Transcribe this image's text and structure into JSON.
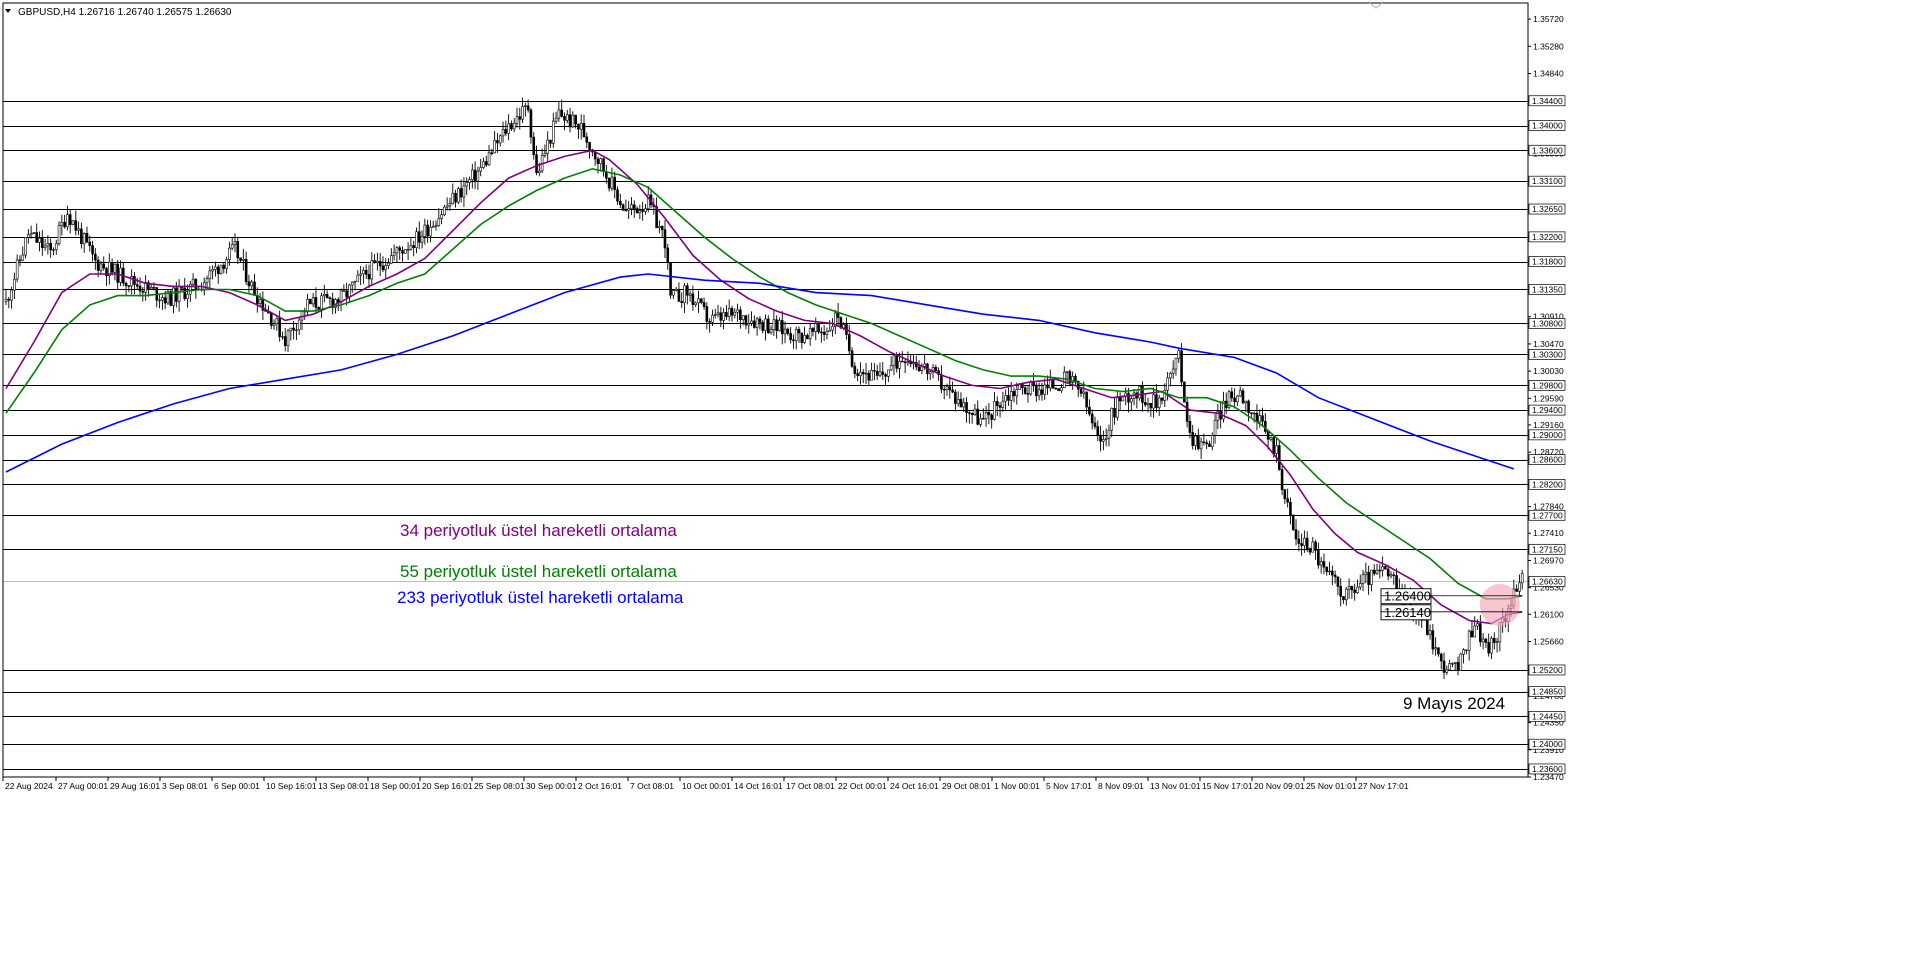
{
  "chart_data": {
    "type": "candlestick",
    "symbol_header": "GBPUSD,H4  1.26716 1.26740 1.26575 1.26630",
    "ylim": [
      1.2347,
      1.3598
    ],
    "y_ticks": [
      "1.35720",
      "1.35280",
      "1.34840",
      "1.34400",
      "1.34000",
      "1.33600",
      "1.33550",
      "1.33100",
      "1.32650",
      "1.32200",
      "1.31800",
      "1.31350",
      "1.30910",
      "1.30800",
      "1.30470",
      "1.30300",
      "1.30030",
      "1.29800",
      "1.29590",
      "1.29400",
      "1.29160",
      "1.29000",
      "1.28720",
      "1.28600",
      "1.28200",
      "1.27840",
      "1.27700",
      "1.27410",
      "1.27150",
      "1.26970",
      "1.26630",
      "1.26530",
      "1.26100",
      "1.25660",
      "1.25200",
      "1.24850",
      "1.24780",
      "1.24450",
      "1.24350",
      "1.23910",
      "1.24000",
      "1.23600",
      "1.23470"
    ],
    "x_ticks": [
      "22 Aug 2024",
      "27 Aug 00:01",
      "29 Aug 16:01",
      "3 Sep 08:01",
      "6 Sep 00:01",
      "10 Sep 16:01",
      "13 Sep 08:01",
      "18 Sep 00:01",
      "20 Sep 16:01",
      "25 Sep 08:01",
      "30 Sep 00:01",
      "2 Oct 16:01",
      "7 Oct 08:01",
      "10 Oct 00:01",
      "14 Oct 16:01",
      "17 Oct 08:01",
      "22 Oct 00:01",
      "24 Oct 16:01",
      "29 Oct 08:01",
      "1 Nov 00:01",
      "5 Nov 17:01",
      "8 Nov 09:01",
      "13 Nov 01:01",
      "15 Nov 17:01",
      "20 Nov 09:01",
      "25 Nov 01:01",
      "27 Nov 17:01"
    ],
    "horizontal_levels": [
      1.344,
      1.34,
      1.336,
      1.331,
      1.3265,
      1.322,
      1.318,
      1.3135,
      1.308,
      1.303,
      1.298,
      1.294,
      1.29,
      1.286,
      1.282,
      1.277,
      1.2715,
      1.252,
      1.2485,
      1.2445,
      1.24,
      1.236
    ],
    "current_price": 1.2663,
    "price_path": [
      [
        0,
        1.3115
      ],
      [
        8,
        1.3225
      ],
      [
        16,
        1.3195
      ],
      [
        22,
        1.326
      ],
      [
        32,
        1.318
      ],
      [
        44,
        1.315
      ],
      [
        58,
        1.312
      ],
      [
        70,
        1.3145
      ],
      [
        82,
        1.32
      ],
      [
        88,
        1.314
      ],
      [
        100,
        1.3055
      ],
      [
        108,
        1.311
      ],
      [
        120,
        1.312
      ],
      [
        130,
        1.3165
      ],
      [
        140,
        1.3195
      ],
      [
        148,
        1.322
      ],
      [
        160,
        1.328
      ],
      [
        170,
        1.333
      ],
      [
        180,
        1.34
      ],
      [
        187,
        1.343
      ],
      [
        190,
        1.332
      ],
      [
        198,
        1.342
      ],
      [
        206,
        1.3395
      ],
      [
        214,
        1.333
      ],
      [
        222,
        1.326
      ],
      [
        230,
        1.3275
      ],
      [
        236,
        1.3215
      ],
      [
        238,
        1.312
      ],
      [
        244,
        1.313
      ],
      [
        252,
        1.3085
      ],
      [
        262,
        1.3095
      ],
      [
        272,
        1.308
      ],
      [
        284,
        1.306
      ],
      [
        294,
        1.307
      ],
      [
        298,
        1.3095
      ],
      [
        304,
        1.301
      ],
      [
        312,
        1.299
      ],
      [
        322,
        1.303
      ],
      [
        330,
        1.3005
      ],
      [
        340,
        1.296
      ],
      [
        350,
        1.292
      ],
      [
        356,
        1.2955
      ],
      [
        362,
        1.2975
      ],
      [
        372,
        1.2975
      ],
      [
        380,
        1.299
      ],
      [
        385,
        1.297
      ],
      [
        392,
        1.288
      ],
      [
        398,
        1.2955
      ],
      [
        404,
        1.297
      ],
      [
        412,
        1.295
      ],
      [
        420,
        1.3025
      ],
      [
        424,
        1.29
      ],
      [
        430,
        1.288
      ],
      [
        436,
        1.295
      ],
      [
        442,
        1.297
      ],
      [
        450,
        1.291
      ],
      [
        455,
        1.2875
      ],
      [
        458,
        1.28
      ],
      [
        462,
        1.273
      ],
      [
        468,
        1.272
      ],
      [
        472,
        1.268
      ],
      [
        480,
        1.264
      ],
      [
        486,
        1.2665
      ],
      [
        494,
        1.268
      ],
      [
        500,
        1.264
      ],
      [
        508,
        1.26
      ],
      [
        514,
        1.253
      ],
      [
        520,
        1.252
      ],
      [
        526,
        1.26
      ],
      [
        530,
        1.2555
      ],
      [
        534,
        1.257
      ],
      [
        540,
        1.265
      ],
      [
        543,
        1.2663
      ]
    ],
    "series": [
      {
        "name": "34 periyotluk üstel hareketli ortalama",
        "color": "#800080",
        "points": [
          [
            0,
            1.2975
          ],
          [
            10,
            1.305
          ],
          [
            20,
            1.313
          ],
          [
            30,
            1.316
          ],
          [
            40,
            1.316
          ],
          [
            50,
            1.3145
          ],
          [
            60,
            1.314
          ],
          [
            70,
            1.314
          ],
          [
            80,
            1.313
          ],
          [
            90,
            1.311
          ],
          [
            100,
            1.3085
          ],
          [
            110,
            1.3095
          ],
          [
            120,
            1.3115
          ],
          [
            130,
            1.314
          ],
          [
            140,
            1.316
          ],
          [
            150,
            1.3185
          ],
          [
            160,
            1.323
          ],
          [
            170,
            1.3275
          ],
          [
            180,
            1.3315
          ],
          [
            190,
            1.3335
          ],
          [
            200,
            1.335
          ],
          [
            210,
            1.336
          ],
          [
            216,
            1.3345
          ],
          [
            226,
            1.3305
          ],
          [
            236,
            1.325
          ],
          [
            246,
            1.319
          ],
          [
            256,
            1.315
          ],
          [
            266,
            1.312
          ],
          [
            276,
            1.31
          ],
          [
            286,
            1.3085
          ],
          [
            296,
            1.308
          ],
          [
            306,
            1.306
          ],
          [
            316,
            1.3035
          ],
          [
            326,
            1.3015
          ],
          [
            336,
            1.2995
          ],
          [
            346,
            1.298
          ],
          [
            356,
            1.2975
          ],
          [
            366,
            1.2985
          ],
          [
            376,
            1.299
          ],
          [
            386,
            1.2975
          ],
          [
            396,
            1.296
          ],
          [
            406,
            1.2965
          ],
          [
            414,
            1.297
          ],
          [
            424,
            1.294
          ],
          [
            434,
            1.2935
          ],
          [
            444,
            1.2915
          ],
          [
            452,
            1.288
          ],
          [
            460,
            1.2835
          ],
          [
            468,
            1.278
          ],
          [
            476,
            1.274
          ],
          [
            484,
            1.271
          ],
          [
            494,
            1.269
          ],
          [
            504,
            1.2665
          ],
          [
            514,
            1.2625
          ],
          [
            524,
            1.26
          ],
          [
            532,
            1.2595
          ],
          [
            538,
            1.261
          ],
          [
            543,
            1.2614
          ]
        ]
      },
      {
        "name": "55 periyotluk üstel hareketli ortalama",
        "color": "#008000",
        "points": [
          [
            0,
            1.2935
          ],
          [
            10,
            1.3
          ],
          [
            20,
            1.307
          ],
          [
            30,
            1.311
          ],
          [
            40,
            1.3125
          ],
          [
            50,
            1.3125
          ],
          [
            60,
            1.313
          ],
          [
            70,
            1.3135
          ],
          [
            80,
            1.3135
          ],
          [
            90,
            1.3125
          ],
          [
            100,
            1.31
          ],
          [
            110,
            1.31
          ],
          [
            120,
            1.311
          ],
          [
            130,
            1.3125
          ],
          [
            140,
            1.3145
          ],
          [
            150,
            1.316
          ],
          [
            160,
            1.32
          ],
          [
            170,
            1.324
          ],
          [
            180,
            1.327
          ],
          [
            190,
            1.3295
          ],
          [
            200,
            1.3315
          ],
          [
            210,
            1.333
          ],
          [
            220,
            1.332
          ],
          [
            230,
            1.33
          ],
          [
            240,
            1.326
          ],
          [
            250,
            1.322
          ],
          [
            260,
            1.3185
          ],
          [
            270,
            1.3155
          ],
          [
            280,
            1.313
          ],
          [
            290,
            1.311
          ],
          [
            300,
            1.3095
          ],
          [
            310,
            1.308
          ],
          [
            320,
            1.306
          ],
          [
            330,
            1.304
          ],
          [
            340,
            1.302
          ],
          [
            350,
            1.3005
          ],
          [
            360,
            1.2995
          ],
          [
            370,
            1.2995
          ],
          [
            380,
            1.299
          ],
          [
            390,
            1.2975
          ],
          [
            400,
            1.297
          ],
          [
            410,
            1.2975
          ],
          [
            420,
            1.296
          ],
          [
            430,
            1.296
          ],
          [
            440,
            1.2945
          ],
          [
            450,
            1.2915
          ],
          [
            460,
            1.2875
          ],
          [
            470,
            1.283
          ],
          [
            480,
            1.279
          ],
          [
            490,
            1.276
          ],
          [
            500,
            1.273
          ],
          [
            510,
            1.27
          ],
          [
            520,
            1.266
          ],
          [
            530,
            1.2635
          ],
          [
            538,
            1.2635
          ],
          [
            543,
            1.264
          ]
        ]
      },
      {
        "name": "233 periyotluk üstel hareketli ortalama",
        "color": "#0000ff",
        "points": [
          [
            0,
            1.284
          ],
          [
            20,
            1.2885
          ],
          [
            40,
            1.292
          ],
          [
            60,
            1.295
          ],
          [
            80,
            1.2975
          ],
          [
            100,
            1.299
          ],
          [
            120,
            1.3005
          ],
          [
            140,
            1.303
          ],
          [
            160,
            1.306
          ],
          [
            180,
            1.3095
          ],
          [
            200,
            1.313
          ],
          [
            220,
            1.3155
          ],
          [
            230,
            1.316
          ],
          [
            250,
            1.315
          ],
          [
            270,
            1.3145
          ],
          [
            290,
            1.313
          ],
          [
            310,
            1.3125
          ],
          [
            330,
            1.311
          ],
          [
            350,
            1.3095
          ],
          [
            370,
            1.3085
          ],
          [
            390,
            1.3065
          ],
          [
            410,
            1.305
          ],
          [
            420,
            1.304
          ],
          [
            440,
            1.3025
          ],
          [
            455,
            1.3
          ],
          [
            470,
            1.296
          ],
          [
            490,
            1.2925
          ],
          [
            510,
            1.289
          ],
          [
            530,
            1.286
          ],
          [
            540,
            1.2845
          ]
        ]
      }
    ],
    "price_labels": [
      "1.26400",
      "1.26140"
    ],
    "highlight_color": "#f4a6b8",
    "annotations": [
      "34 periyotluk üstel hareketli ortalama",
      "55 periyotluk üstel hareketli ortalama",
      "233 periyotluk üstel hareketli ortalama",
      "9 Mayıs 2024"
    ],
    "colors": {
      "bull": "#ffffff",
      "bear": "#000000",
      "levels": "#000000",
      "grid_current": "#c0c0c0"
    }
  }
}
